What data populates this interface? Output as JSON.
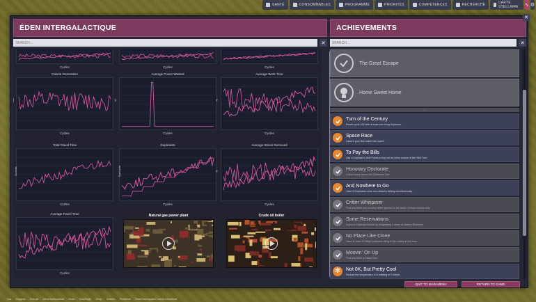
{
  "topbar": {
    "buttons": [
      {
        "label": "SANTÉ",
        "icon": "heart-icon"
      },
      {
        "label": "CONSOMMABLES",
        "icon": "food-icon"
      },
      {
        "label": "PROGRAMME",
        "icon": "clock-icon"
      },
      {
        "label": "PRIORITÉS",
        "icon": "priority-icon"
      },
      {
        "label": "COMPÉTENCES",
        "icon": "skill-icon"
      },
      {
        "label": "RECHERCHE",
        "icon": "research-icon"
      },
      {
        "label": "CARTE STELLAIRE",
        "icon": "star-map-icon"
      }
    ]
  },
  "left": {
    "title": "ÉDEN INTERGALACTIQUE",
    "search_placeholder": "SEARCH...",
    "clear": "✕",
    "charts": [
      {
        "title": "",
        "xlabel": "Cycles"
      },
      {
        "title": "",
        "xlabel": "Cycles"
      },
      {
        "title": "",
        "xlabel": "Cycles"
      },
      {
        "title": "Calorie Generation",
        "xlabel": "Cycles",
        "ylabel": "kcal"
      },
      {
        "title": "Average Power Wasted",
        "xlabel": "Cycles",
        "ylabel": "kJ"
      },
      {
        "title": "Average Work Time",
        "xlabel": "Cycles",
        "ylabel": "%"
      },
      {
        "title": "Total Travel Time",
        "xlabel": "Cycles",
        "ylabel": "Seconds"
      },
      {
        "title": "Duplicants",
        "xlabel": "Cycles",
        "ylabel": "Duplicants"
      },
      {
        "title": "Average Stress Removed",
        "xlabel": "Cycles",
        "ylabel": "%"
      },
      {
        "title": "Average Travel Time",
        "xlabel": "Cycles",
        "ylabel": "s"
      }
    ],
    "videos": [
      {
        "title": "Natural gas power plant"
      },
      {
        "title": "Crude oil boiler"
      }
    ]
  },
  "right": {
    "title": "ACHIEVEMENTS",
    "search_placeholder": "SEARCH...",
    "clear": "✕",
    "close": "✕",
    "big": [
      {
        "name": "The Great Escape"
      },
      {
        "name": "Home Sweet Home"
      }
    ],
    "more": "—",
    "items": [
      {
        "title": "Turn of the Century",
        "desc": "Reach cycle 100 with at least one living Duplicant.",
        "locked": false
      },
      {
        "title": "Space Race",
        "desc": "Launch your first rocket into space.",
        "locked": false
      },
      {
        "title": "To Pay the Bills",
        "desc": "Use a Duplicant's Skill Points to buy out an entire branch of the Skill Tree.",
        "locked": false
      },
      {
        "title": "Honorary Doctorate",
        "desc": "Unlock every item in the Research Tree.",
        "locked": true
      },
      {
        "title": "And Nowhere to Go",
        "desc": "Have 8 Duplicants wear non-default clothing simultaneously.",
        "locked": false
      },
      {
        "title": "Critter Whisperer",
        "desc": "Find and tame one of every critter species in the world. Default morphs only.",
        "locked": true
      },
      {
        "title": "Some Reservations",
        "desc": "Improve Duplicant Morale by designating 4 areas as Nature Reserves.",
        "locked": true
      },
      {
        "title": "No Place Like Clone",
        "desc": "Have at least 20 living Duplicants living in the colony at one time.",
        "locked": true
      },
      {
        "title": "Moovin' On Up",
        "desc": "Find and tame a Gassy Moo.",
        "locked": true
      },
      {
        "title": "Not 0K, But Pretty Cool",
        "desc": "Reduce the temperature of a building to 0 Kelvin.",
        "locked": false
      }
    ]
  },
  "buttons": {
    "quit": "QUIT TO MAIN MENU",
    "return": "RETURN TO GAME"
  },
  "bottombar": [
    "Gaz",
    "Oxygène",
    "Énergie",
    "Aliments/Nourriture",
    "Santé",
    "Sols/Étage",
    "Temp.",
    "Moisiss.",
    "Plomberie",
    "Terre/Gaz/Liquide/Conduit d'électricité"
  ],
  "chart_data": [
    {
      "type": "line",
      "title": "Calorie Generation",
      "xlabel": "Cycles",
      "ylabel": "kcal"
    },
    {
      "type": "line",
      "title": "Average Power Wasted",
      "xlabel": "Cycles",
      "ylabel": "kJ"
    },
    {
      "type": "line",
      "title": "Average Work Time",
      "xlabel": "Cycles",
      "ylabel": "%"
    },
    {
      "type": "line",
      "title": "Total Travel Time",
      "xlabel": "Cycles",
      "ylabel": "Seconds"
    },
    {
      "type": "line",
      "title": "Duplicants",
      "xlabel": "Cycles",
      "ylabel": "Duplicants"
    },
    {
      "type": "line",
      "title": "Average Stress Removed",
      "xlabel": "Cycles",
      "ylabel": "%"
    },
    {
      "type": "line",
      "title": "Average Travel Time",
      "xlabel": "Cycles",
      "ylabel": "s"
    }
  ],
  "colors": {
    "accent": "#7c3a5d",
    "line": "#d2569a",
    "panel": "#262734",
    "achieved": "#e7862a"
  }
}
